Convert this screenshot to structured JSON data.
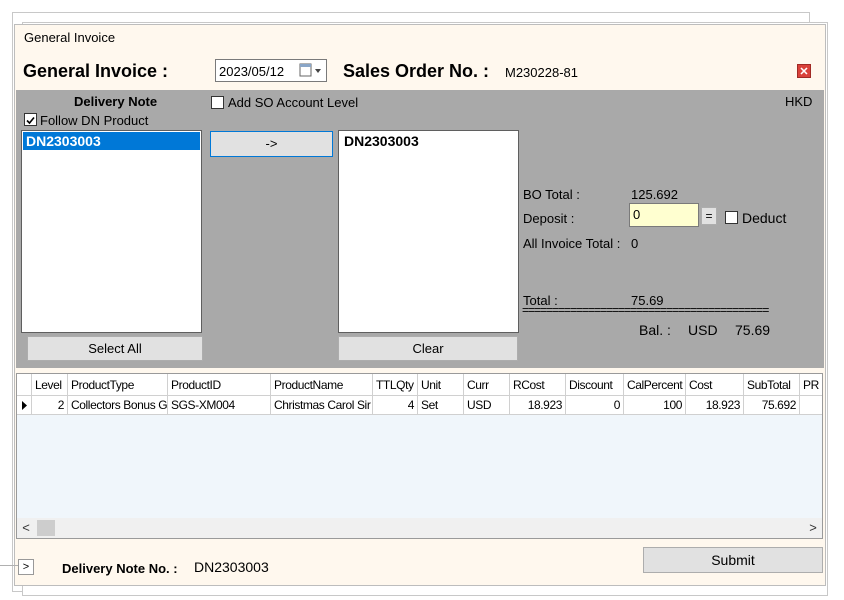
{
  "window": {
    "title": "General Invoice"
  },
  "header": {
    "label": "General Invoice :",
    "date": "2023/05/12",
    "so_label": "Sales Order No. :",
    "so_value": "M230228-81"
  },
  "left_panel": {
    "title": "Delivery Note",
    "follow_label": "Follow DN Product",
    "items": [
      "DN2303003"
    ],
    "select_all": "Select All"
  },
  "middle": {
    "add_so_label": "Add SO Account Level",
    "arrow_button": "->",
    "selected_items": [
      "DN2303003"
    ],
    "clear": "Clear"
  },
  "totals": {
    "currency": "HKD",
    "bo_total_label": "BO Total :",
    "bo_total_value": "125.692",
    "deposit_label": "Deposit :",
    "deposit_value": "0",
    "equals": "=",
    "deduct_label": "Deduct",
    "all_invoice_label": "All Invoice Total :",
    "all_invoice_value": "0",
    "total_label": "Total :",
    "total_value": "75.69",
    "separator": "=========================================",
    "bal_label": "Bal. :",
    "bal_currency": "USD",
    "bal_value": "75.69"
  },
  "grid": {
    "columns": [
      "Level",
      "ProductType",
      "ProductID",
      "ProductName",
      "TTLQty",
      "Unit",
      "Curr",
      "RCost",
      "Discount",
      "CalPercent",
      "Cost",
      "SubTotal",
      "PR"
    ],
    "rows": [
      [
        "2",
        "Collectors Bonus G",
        "SGS-XM004",
        "Christmas Carol Sir",
        "4",
        "Set",
        "USD",
        "18.923",
        "0",
        "100",
        "18.923",
        "75.692",
        ""
      ]
    ]
  },
  "footer": {
    "dn_label": "Delivery Note No. :",
    "dn_value": "DN2303003",
    "submit": "Submit",
    "expander": ">"
  }
}
